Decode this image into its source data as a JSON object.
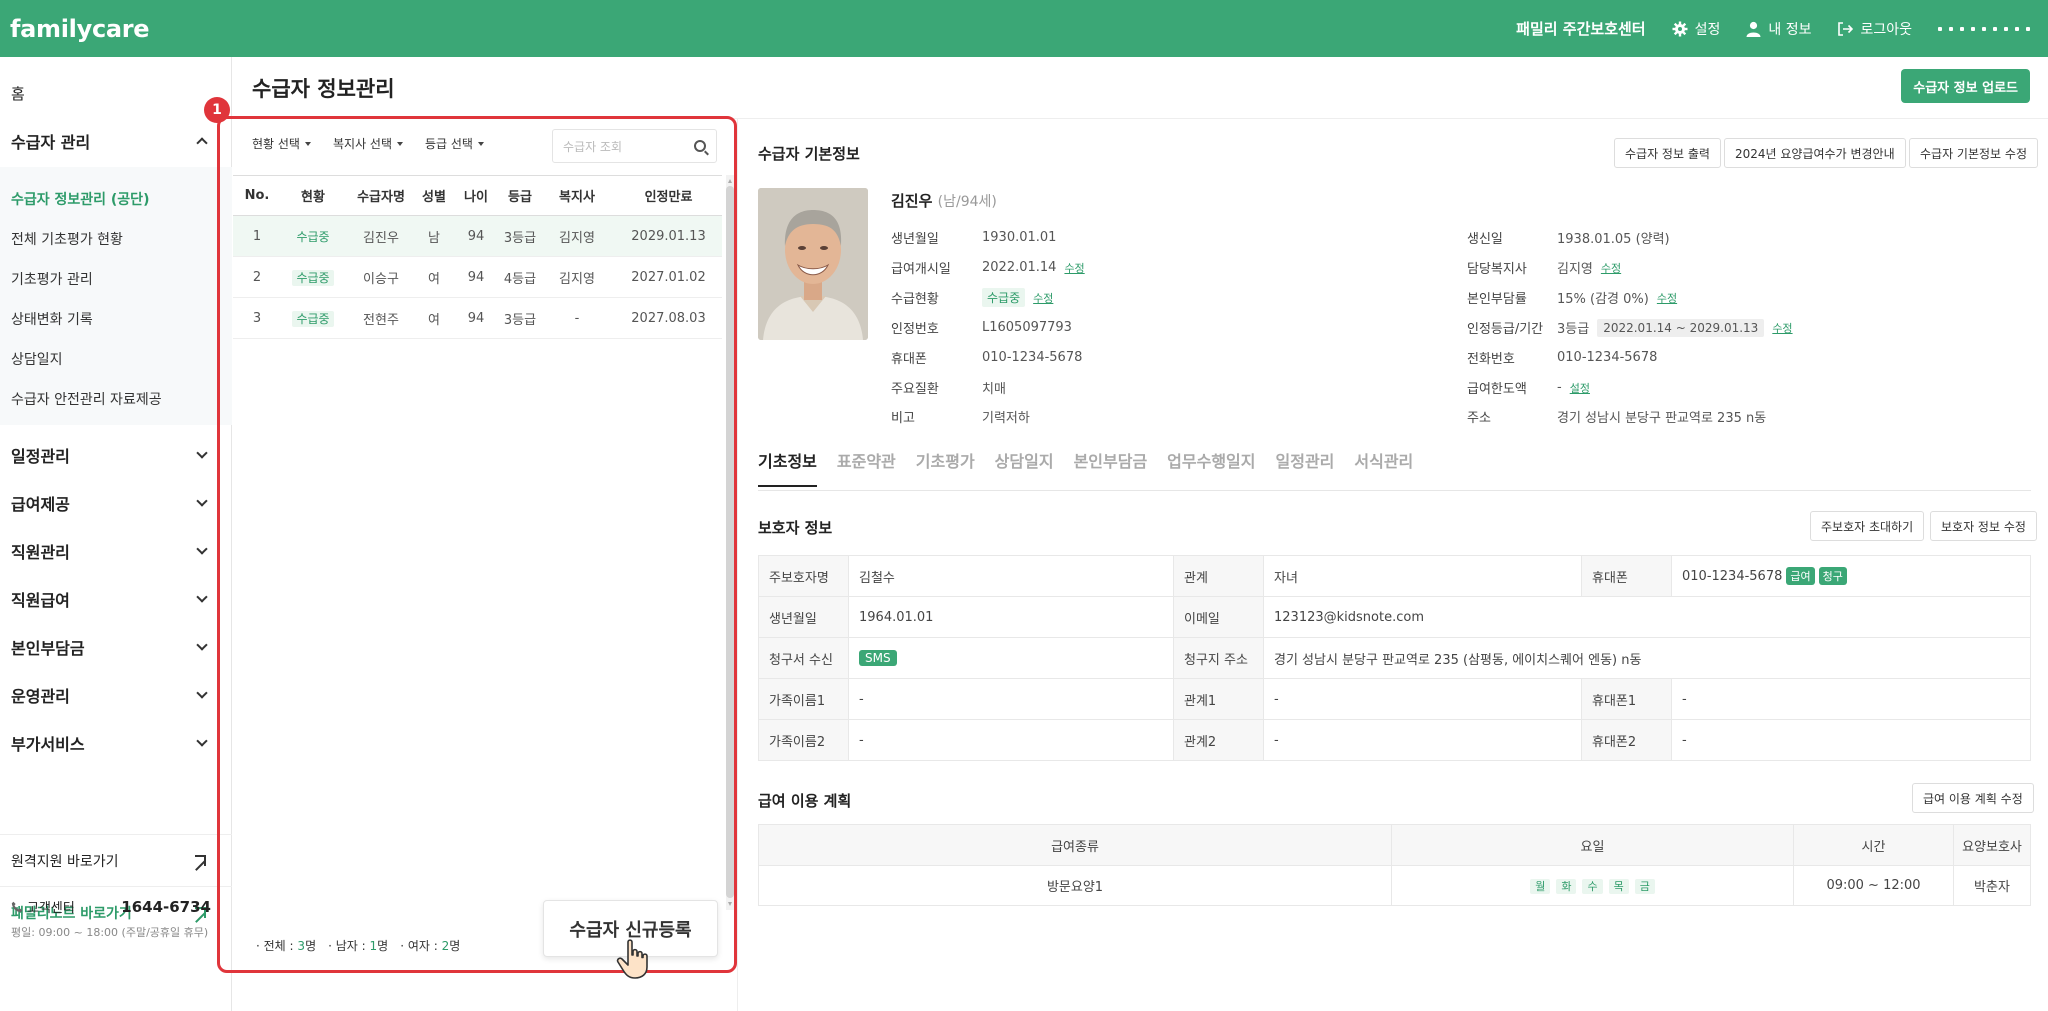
{
  "app": {
    "logo": "familycare",
    "center_name": "패밀리 주간보호센터",
    "settings": "설정",
    "my_info": "내 정보",
    "logout": "로그아웃"
  },
  "sidebar": {
    "home": "홈",
    "recipient_mgmt": "수급자 관리",
    "sub_items": [
      "수급자 정보관리 (공단)",
      "전체 기초평가 현황",
      "기초평가 관리",
      "상태변화 기록",
      "상담일지",
      "수급자 안전관리 자료제공"
    ],
    "sections": [
      "일정관리",
      "급여제공",
      "직원관리",
      "직원급여",
      "본인부담금",
      "운영관리",
      "부가서비스"
    ],
    "remote_link": "원격지원 바로가기",
    "familynote_link": "패밀리노트 바로가기",
    "cs_label": "고객센터",
    "cs_phone": "1644-6734",
    "cs_hours": "평일: 09:00 ~ 18:00 (주말/공휴일 휴무)"
  },
  "page": {
    "title": "수급자 정보관리",
    "upload_button": "수급자 정보 업로드",
    "step_badge": "1"
  },
  "list": {
    "filters": [
      "현황 선택",
      "복지사 선택",
      "등급 선택"
    ],
    "search_placeholder": "수급자 조회",
    "columns": [
      "No.",
      "현황",
      "수급자명",
      "성별",
      "나이",
      "등급",
      "복지사",
      "인정만료"
    ],
    "rows": [
      [
        "1",
        "수급중",
        "김진우",
        "남",
        "94",
        "3등급",
        "김지영",
        "2029.01.13"
      ],
      [
        "2",
        "수급중",
        "이승구",
        "여",
        "94",
        "4등급",
        "김지영",
        "2027.01.02"
      ],
      [
        "3",
        "수급중",
        "전현주",
        "여",
        "94",
        "3등급",
        "-",
        "2027.08.03"
      ]
    ],
    "count_total_label": "전체 :",
    "count_total": "3",
    "count_male_label": "남자 :",
    "count_male": "1",
    "count_female_label": "여자 :",
    "count_female": "2",
    "count_unit": "명",
    "new_button": "수급자 신규등록"
  },
  "basic": {
    "title": "수급자 기본정보",
    "btn_print": "수급자 정보 출력",
    "btn_notice": "2024년 요양급여수가 변경안내",
    "btn_edit": "수급자 기본정보 수정",
    "name": "김진우",
    "name_meta": "(남/94세)",
    "edit_label": "수정",
    "setting_label": "설정",
    "left": [
      {
        "k": "생년월일",
        "v": "1930.01.01"
      },
      {
        "k": "급여개시일",
        "v": "2022.01.14"
      },
      {
        "k": "수급현황",
        "v": "수급중"
      },
      {
        "k": "인정번호",
        "v": "L1605097793"
      },
      {
        "k": "휴대폰",
        "v": "010-1234-5678"
      },
      {
        "k": "주요질환",
        "v": "치매"
      },
      {
        "k": "비고",
        "v": "기력저하"
      }
    ],
    "right": [
      {
        "k": "생신일",
        "v": "1938.01.05 (양력)"
      },
      {
        "k": "담당복지사",
        "v": "김지영"
      },
      {
        "k": "본인부담률",
        "v": "15% (감경 0%)"
      },
      {
        "k": "인정등급/기간",
        "v": "3등급",
        "v2": "2022.01.14 ~ 2029.01.13"
      },
      {
        "k": "전화번호",
        "v": "010-1234-5678"
      },
      {
        "k": "급여한도액",
        "v": "-"
      },
      {
        "k": "주소",
        "v": "경기 성남시 분당구 판교역로 235 n동"
      }
    ]
  },
  "tabs": [
    "기초정보",
    "표준약관",
    "기초평가",
    "상담일지",
    "본인부담금",
    "업무수행일지",
    "일정관리",
    "서식관리"
  ],
  "guardian": {
    "title": "보호자 정보",
    "btn_invite": "주보호자 초대하기",
    "btn_edit": "보호자 정보 수정",
    "main_name_k": "주보호자명",
    "main_name_v": "김철수",
    "relation_k": "관계",
    "relation_v": "자녀",
    "phone_k": "휴대폰",
    "phone_v": "010-1234-5678",
    "tag_benefit": "급여",
    "tag_bill": "청구",
    "birth_k": "생년월일",
    "birth_v": "1964.01.01",
    "email_k": "이메일",
    "email_v": "123123@kidsnote.com",
    "bill_recv_k": "청구서 수신",
    "bill_recv_v": "SMS",
    "bill_addr_k": "청구지 주소",
    "bill_addr_v": "경기 성남시 분당구 판교역로 235 (삼평동, 에이치스퀘어 엔동) n동",
    "fam1_k": "가족이름1",
    "fam1_v": "-",
    "rel1_k": "관계1",
    "rel1_v": "-",
    "ph1_k": "휴대폰1",
    "ph1_v": "-",
    "fam2_k": "가족이름2",
    "fam2_v": "-",
    "rel2_k": "관계2",
    "rel2_v": "-",
    "ph2_k": "휴대폰2",
    "ph2_v": "-"
  },
  "plan": {
    "title": "급여 이용 계획",
    "btn_edit": "급여 이용 계획 수정",
    "columns": [
      "급여종류",
      "요일",
      "시간",
      "요양보호사"
    ],
    "row": {
      "type": "방문요양1",
      "days": [
        "월",
        "화",
        "수",
        "목",
        "금"
      ],
      "time": "09:00 ~ 12:00",
      "caregiver": "박춘자"
    }
  },
  "colors": {
    "brand": "#3ba776",
    "highlight": "#e0353b"
  }
}
